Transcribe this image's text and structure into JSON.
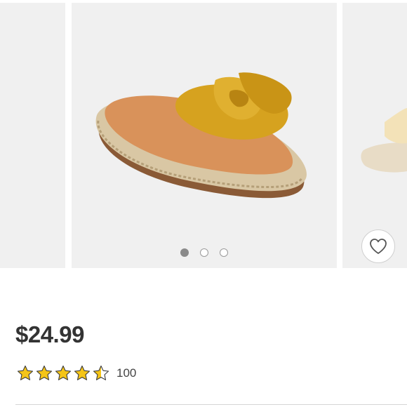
{
  "product": {
    "price": "$24.99",
    "rating": 4.5,
    "rating_max": 5,
    "review_count": "100"
  },
  "carousel": {
    "image_count": 3,
    "active_index": 0
  },
  "icons": {
    "favorite": "heart-outline-icon",
    "star": "star-icon"
  },
  "colors": {
    "star_fill": "#f5c518",
    "price_text": "#333333",
    "dot_active": "#8a8a8a"
  }
}
